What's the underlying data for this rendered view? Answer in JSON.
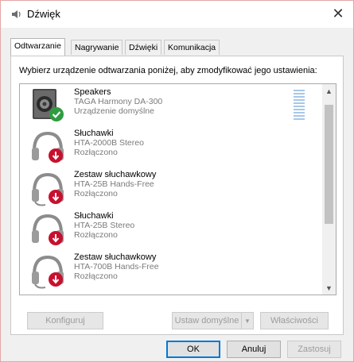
{
  "window": {
    "title": "Dźwięk",
    "close_label": "✕"
  },
  "tabs": [
    {
      "label": "Odtwarzanie",
      "active": true
    },
    {
      "label": "Nagrywanie",
      "active": false
    },
    {
      "label": "Dźwięki",
      "active": false
    },
    {
      "label": "Komunikacja",
      "active": false
    }
  ],
  "instruction": "Wybierz urządzenie odtwarzania poniżej, aby zmodyfikować jego ustawienia:",
  "devices": [
    {
      "name": "Speakers",
      "model": "TAGA Harmony DA-300",
      "status": "Urządzenie domyślne",
      "icon": "speaker-icon",
      "badge": "default-check-icon"
    },
    {
      "name": "Słuchawki",
      "model": "HTA-2000B Stereo",
      "status": "Rozłączono",
      "icon": "headphones-icon",
      "badge": "disconnected-arrow-icon"
    },
    {
      "name": "Zestaw słuchawkowy",
      "model": "HTA-25B Hands-Free",
      "status": "Rozłączono",
      "icon": "headset-icon",
      "badge": "disconnected-arrow-icon"
    },
    {
      "name": "Słuchawki",
      "model": "HTA-25B Stereo",
      "status": "Rozłączono",
      "icon": "headphones-icon",
      "badge": "disconnected-arrow-icon"
    },
    {
      "name": "Zestaw słuchawkowy",
      "model": "HTA-700B Hands-Free",
      "status": "Rozłączono",
      "icon": "headset-icon",
      "badge": "disconnected-arrow-icon"
    }
  ],
  "buttons": {
    "configure": "Konfiguruj",
    "set_default": "Ustaw domyślne",
    "properties": "Właściwości",
    "ok": "OK",
    "cancel": "Anuluj",
    "apply": "Zastosuj"
  },
  "colors": {
    "accent": "#0078d7",
    "default_badge": "#2e9d3f",
    "disconnected_badge": "#c8102e",
    "level_meter": "#a7c7e8"
  }
}
